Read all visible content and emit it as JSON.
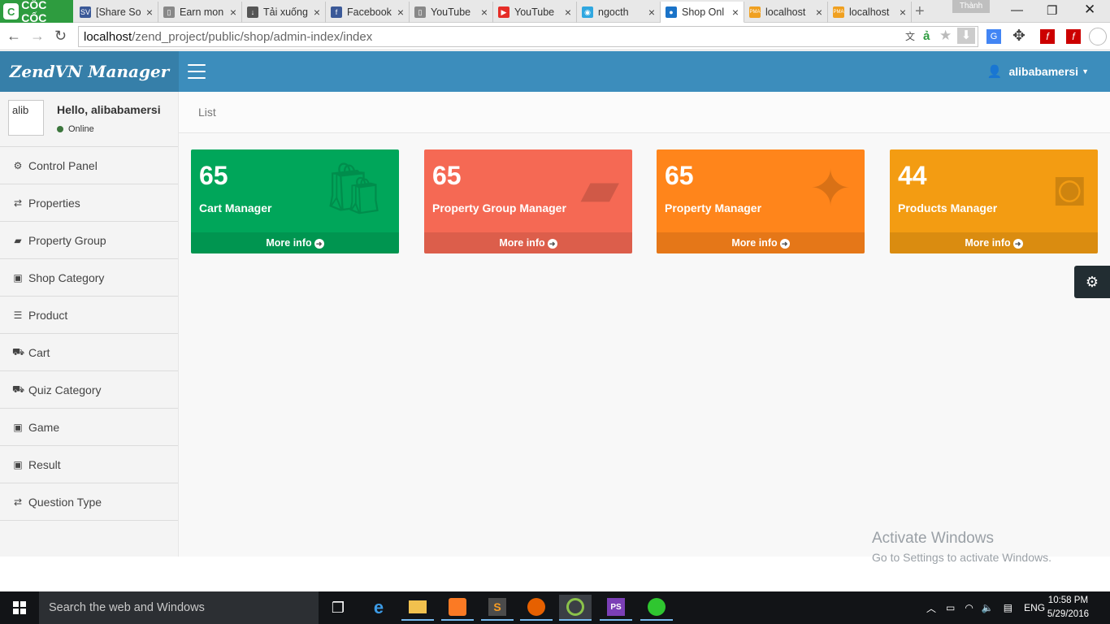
{
  "browser": {
    "logo_text": "CỐC CỐC",
    "tabs": [
      {
        "label": "[Share So",
        "icon": "sv-icon",
        "color": "#3b5998",
        "glyph": "SV"
      },
      {
        "label": "Earn mon",
        "icon": "page-icon",
        "color": "#888888",
        "glyph": "▯"
      },
      {
        "label": "Tải xuống",
        "icon": "download-icon",
        "color": "#555555",
        "glyph": "↓"
      },
      {
        "label": "Facebook",
        "icon": "facebook-icon",
        "color": "#3b5998",
        "glyph": "f"
      },
      {
        "label": "YouTube",
        "icon": "page-icon",
        "color": "#888888",
        "glyph": "▯"
      },
      {
        "label": "YouTube",
        "icon": "youtube-icon",
        "color": "#e52d27",
        "glyph": "▶"
      },
      {
        "label": "ngocth",
        "icon": "chat-icon",
        "color": "#2fa7e0",
        "glyph": "◉"
      },
      {
        "label": "Shop Onl",
        "icon": "shop-icon",
        "color": "#1a73c8",
        "glyph": "●"
      },
      {
        "label": "localhost",
        "icon": "pma-icon",
        "color": "#f0a020",
        "glyph": "PMA"
      },
      {
        "label": "localhost",
        "icon": "pma-icon",
        "color": "#f0a020",
        "glyph": "PMA"
      }
    ],
    "profile_name": "Thành",
    "url_host": "localhost",
    "url_path": "/zend_project/public/shop/admin-index/index"
  },
  "header": {
    "brand": "ZendVN Manager",
    "username": "alibabamersi"
  },
  "sidebar": {
    "avatar_alt": "alib",
    "greeting": "Hello, alibabamersi",
    "status": "Online",
    "items": [
      {
        "label": "Control Panel",
        "icon": "dashboard-icon",
        "glyph": "⚙"
      },
      {
        "label": "Properties",
        "icon": "shuffle-icon",
        "glyph": "⇄"
      },
      {
        "label": "Property Group",
        "icon": "book-icon",
        "glyph": "▰"
      },
      {
        "label": "Shop Category",
        "icon": "briefcase-icon",
        "glyph": "▣"
      },
      {
        "label": "Product",
        "icon": "list-icon",
        "glyph": "☰"
      },
      {
        "label": "Cart",
        "icon": "cart-icon",
        "glyph": "⛟"
      },
      {
        "label": "Quiz Category",
        "icon": "cart-icon",
        "glyph": "⛟"
      },
      {
        "label": "Game",
        "icon": "briefcase-icon",
        "glyph": "▣"
      },
      {
        "label": "Result",
        "icon": "briefcase-icon",
        "glyph": "▣"
      },
      {
        "label": "Question Type",
        "icon": "shuffle-icon",
        "glyph": "⇄"
      }
    ]
  },
  "content": {
    "breadcrumb": "List",
    "boxes": [
      {
        "number": "65",
        "title": "Cart Manager",
        "more": "More info",
        "color": "#00a65a",
        "icon": "shopping-bag-icon",
        "glyph": "🛍"
      },
      {
        "number": "65",
        "title": "Property Group Manager",
        "more": "More info",
        "color": "#f56954",
        "icon": "folder-icon",
        "glyph": "▰"
      },
      {
        "number": "65",
        "title": "Property Manager",
        "more": "More info",
        "color": "#ff851b",
        "icon": "magic-wand-icon",
        "glyph": "✦"
      },
      {
        "number": "44",
        "title": "Products Manager",
        "more": "More info",
        "color": "#f39c12",
        "icon": "music-player-icon",
        "glyph": "◙"
      }
    ]
  },
  "watermark": {
    "line1": "Activate Windows",
    "line2": "Go to Settings to activate Windows."
  },
  "taskbar": {
    "search_placeholder": "Search the web and Windows",
    "language": "ENG",
    "time": "10:58 PM",
    "date": "5/29/2016"
  }
}
